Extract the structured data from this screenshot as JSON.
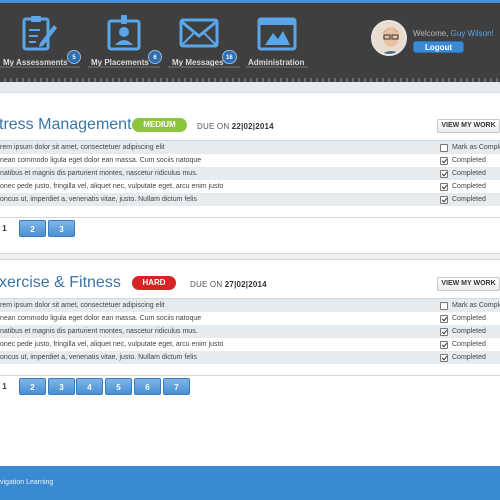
{
  "nav": {
    "items": [
      {
        "label": "My Assessments",
        "badge": "5",
        "icon": "clipboard-pencil-icon"
      },
      {
        "label": "My Placements",
        "badge": "6",
        "icon": "id-badge-icon"
      },
      {
        "label": "My Messages",
        "badge": "16",
        "icon": "envelope-icon"
      },
      {
        "label": "Administration",
        "badge": "",
        "icon": "toolbox-icon"
      }
    ]
  },
  "user": {
    "welcome": "Welcome,",
    "name": "Guy Wilson!",
    "logout": "Logout"
  },
  "sections": [
    {
      "title": "tress Management",
      "difficulty": "MEDIUM",
      "difficulty_color": "#8cc43c",
      "due_label": "DUE ON",
      "due_date": "22|02|2014",
      "view_label": "VIEW MY WORK",
      "rows": [
        {
          "text": "rem ipsum dolor sit amet, consectetuer adipiscing elit",
          "checked": false,
          "status": "Mark as Complete"
        },
        {
          "text": "nean commodo ligula eget dolor ean massa. Cum sociis natoque",
          "checked": true,
          "status": "Completed"
        },
        {
          "text": "natibus et magnis dis parturient montes, nascetur ridiculus mus.",
          "checked": true,
          "status": "Completed"
        },
        {
          "text": "onec pede justo, fringilla vel, aliquet nec, vulputate eget, arcu enim justo",
          "checked": true,
          "status": "Completed"
        },
        {
          "text": "oncus ut, imperdiet a, venenatis vitae, justo. Nullam dictum felis",
          "checked": true,
          "status": "Completed"
        }
      ],
      "pages": [
        "1",
        "2",
        "3"
      ]
    },
    {
      "title": "xercise & Fitness",
      "difficulty": "HARD",
      "difficulty_color": "#d42424",
      "due_label": "DUE ON",
      "due_date": "27|02|2014",
      "view_label": "VIEW MY WORK",
      "rows": [
        {
          "text": "rem ipsum dolor sit amet, consectetuer adipiscing elit",
          "checked": false,
          "status": "Mark as Complete"
        },
        {
          "text": "nean commodo ligula eget dolor ean massa. Cum sociis natoque",
          "checked": true,
          "status": "Completed"
        },
        {
          "text": "natibus et magnis dis parturient montes, nascetur ridiculus mus.",
          "checked": true,
          "status": "Completed"
        },
        {
          "text": "onec pede justo, fringilla vel, aliquet nec, vulputate eget, arcu enim justo",
          "checked": true,
          "status": "Completed"
        },
        {
          "text": "oncus ut, imperdiet a, venenatis vitae, justo. Nullam dictum felis",
          "checked": true,
          "status": "Completed"
        }
      ],
      "pages": [
        "1",
        "2",
        "3",
        "4",
        "5",
        "6",
        "7"
      ]
    }
  ],
  "footer": {
    "text": "vigation Learning"
  },
  "colors": {
    "accent": "#3a8ad2",
    "header": "#3f3f3f",
    "title": "#3a75a8"
  }
}
